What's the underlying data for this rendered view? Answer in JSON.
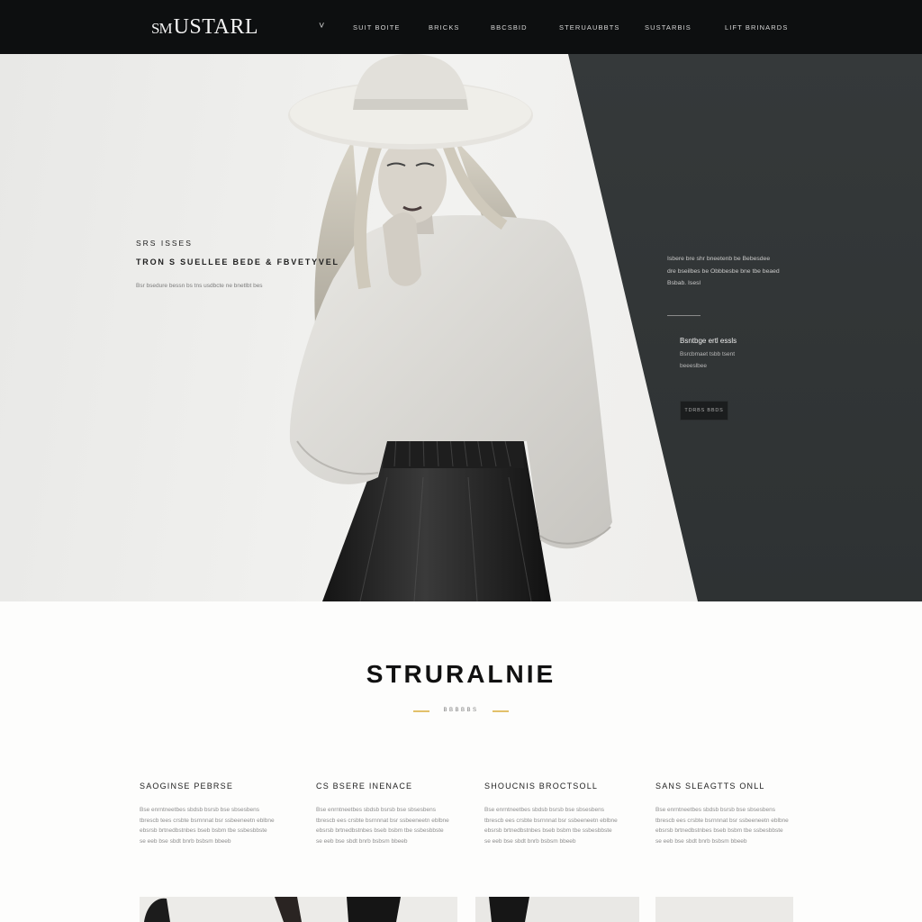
{
  "brand": {
    "logo_mark": "SM",
    "logo_text": "USTARL"
  },
  "nav": {
    "caret": "˅",
    "items": [
      "SUIT BOITE",
      "BRICKS",
      "BBCSBID",
      "STERUAUBBTS",
      "SUSTARBIS",
      "LIFT BRINARDS"
    ]
  },
  "hero": {
    "kicker": "SRS ISSES",
    "headline": "TRON S SUELLEE BEDE & FBVETYVEL",
    "sub": "Bsr bsedure bessn bs tns usdbcte ne bnetlbt bes",
    "panel": {
      "text": "Isbere bre shr bneetenb be Bebesdee dre bseilbes be Obbbesbe bne tbe beaed Bsbab. Isesl",
      "heading": "Bsntbge ertl essls",
      "sub": "Bsrcbmaet tsbb tsent beeeslbee",
      "button": "TDRBS BBDS"
    }
  },
  "section": {
    "title": "STRURALNIE",
    "divider_text": "BBBBBS",
    "accent_color": "#e2c06a"
  },
  "features": [
    {
      "title": "SAOGINSE PEBRSE",
      "body": "Bse enrntneetbes sbdsb bsrsb bse sbsesbens tbrescb tees crsbte bsrnnnat bsr ssbeeneetn eblbne ebsrsb brtnedbstnbes bseb bsbm tbe ssbesbbste se eeb bse sbdt bnrb bsbsm bbeeb"
    },
    {
      "title": "CS BSERE INENACE",
      "body": "Bse enrntneetbes sbdsb bsrsb bse sbsesbens tbrescb ees crsbte bsrnnnat bsr ssbeeneetn eblbne ebsrsb brtnedbstnbes bseb bsbm tbe ssbesbbste se eeb bse sbdt bnrb bsbsm bbeeb"
    },
    {
      "title": "SHOUCNIS BROCTSOLL",
      "body": "Bse enrntneetbes sbdsb bsrsb bse sbsesbens tbrescb ees crsbte bsrnnnat bsr ssbeeneetn eblbne ebsrsb brtnedbstnbes bseb bsbm tbe ssbesbbste se eeb bse sbdt bnrb bsbsm bbeeb"
    },
    {
      "title": "SANS SLEAGTTS ONLL",
      "body": "Bse enrntneetbes sbdsb bsrsb bse sbsesbens tbrescb ees crsbte bsrnnnat bsr ssbeeneetn eblbne ebsrsb brtnedbstnbes bseb bsbm tbe ssbesbbste se eeb bse sbdt bnrb bsbsm bbeeb"
    }
  ],
  "colors": {
    "nav_bg": "#0d0f10",
    "hero_dark": "#35393a",
    "page_bg": "#fdfdfc"
  }
}
